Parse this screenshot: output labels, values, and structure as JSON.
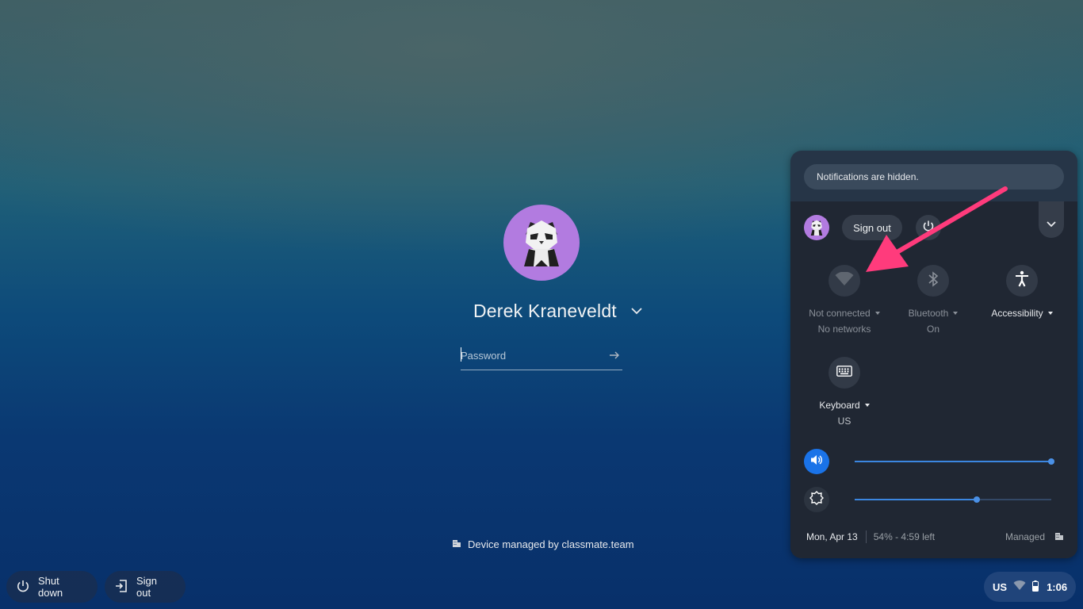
{
  "login": {
    "user_name": "Derek Kraneveldt",
    "password_placeholder": "Password",
    "managed_note": "Device managed by classmate.team"
  },
  "shelf": {
    "shutdown_label": "Shut down",
    "signout_label": "Sign out"
  },
  "tray": {
    "ime": "US",
    "time": "1:06"
  },
  "quick_settings": {
    "notifications_text": "Notifications are hidden.",
    "signout_label": "Sign out",
    "tiles": {
      "network": {
        "label": "Not connected",
        "sublabel": "No networks",
        "icon": "wifi-icon"
      },
      "bluetooth": {
        "label": "Bluetooth",
        "sublabel": "On",
        "icon": "bluetooth-icon"
      },
      "accessibility": {
        "label": "Accessibility",
        "icon": "accessibility-icon"
      },
      "keyboard": {
        "label": "Keyboard",
        "sublabel": "US",
        "icon": "keyboard-icon"
      }
    },
    "volume_level": 1.0,
    "brightness_level": 0.62,
    "date": "Mon, Apr 13",
    "battery": "54% - 4:59 left",
    "managed": "Managed"
  },
  "colors": {
    "accent": "#3b86e0",
    "annotation_arrow": "#ff3b7c",
    "avatar_bg": "#b27be0"
  }
}
